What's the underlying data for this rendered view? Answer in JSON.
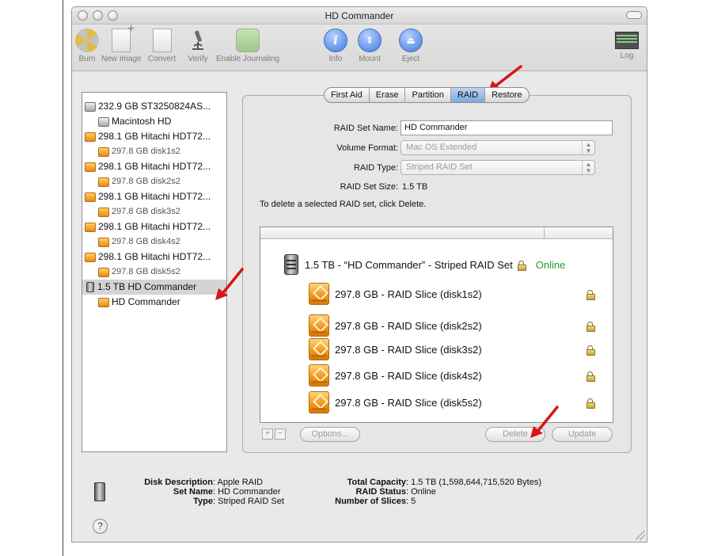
{
  "window": {
    "title": "HD Commander"
  },
  "toolbar": {
    "items": [
      {
        "label": "Burn",
        "icon": "burn-icon"
      },
      {
        "label": "New Image",
        "icon": "new-image-icon"
      },
      {
        "label": "Convert",
        "icon": "convert-icon"
      },
      {
        "label": "Verify",
        "icon": "microscope-icon"
      },
      {
        "label": "Enable Journaling",
        "icon": "journaling-icon"
      },
      {
        "label": "Info",
        "icon": "info-icon"
      },
      {
        "label": "Mount",
        "icon": "mount-icon"
      },
      {
        "label": "Eject",
        "icon": "eject-icon"
      },
      {
        "label": "Log",
        "icon": "log-icon"
      }
    ]
  },
  "sidebar": {
    "items": [
      {
        "label": "232.9 GB ST3250824AS...",
        "icon": "disk-icon"
      },
      {
        "label": "Macintosh HD",
        "icon": "volume-icon"
      },
      {
        "label": "298.1 GB Hitachi HDT72...",
        "icon": "disk-icon"
      },
      {
        "label": "297.8 GB disk1s2",
        "icon": "volume-icon"
      },
      {
        "label": "298.1 GB Hitachi HDT72...",
        "icon": "disk-icon"
      },
      {
        "label": "297.8 GB disk2s2",
        "icon": "volume-icon"
      },
      {
        "label": "298.1 GB Hitachi HDT72...",
        "icon": "disk-icon"
      },
      {
        "label": "297.8 GB disk3s2",
        "icon": "volume-icon"
      },
      {
        "label": "298.1 GB Hitachi HDT72...",
        "icon": "disk-icon"
      },
      {
        "label": "297.8 GB disk4s2",
        "icon": "volume-icon"
      },
      {
        "label": "298.1 GB Hitachi HDT72...",
        "icon": "disk-icon"
      },
      {
        "label": "297.8 GB disk5s2",
        "icon": "volume-icon"
      },
      {
        "label": "1.5 TB HD Commander",
        "icon": "raid-disk-icon"
      },
      {
        "label": "HD Commander",
        "icon": "volume-icon"
      }
    ]
  },
  "tabs": [
    {
      "label": "First Aid"
    },
    {
      "label": "Erase"
    },
    {
      "label": "Partition"
    },
    {
      "label": "RAID",
      "active": true
    },
    {
      "label": "Restore"
    }
  ],
  "raid": {
    "set_name_label": "RAID Set Name:",
    "set_name_value": "HD Commander",
    "volume_format_label": "Volume Format:",
    "volume_format_value": "Mac OS Extended",
    "type_label": "RAID Type:",
    "type_value": "Striped RAID Set",
    "size_label": "RAID Set Size:",
    "size_value": "1.5 TB",
    "delete_note": "To delete a selected RAID set, click Delete.",
    "set_row": {
      "label": "1.5 TB - “HD Commander” - Striped RAID Set",
      "status": "Online"
    },
    "slices": [
      {
        "label": "297.8 GB - RAID Slice (disk1s2)"
      },
      {
        "label": "297.8 GB - RAID Slice (disk2s2)"
      },
      {
        "label": "297.8 GB - RAID Slice (disk3s2)"
      },
      {
        "label": "297.8 GB - RAID Slice (disk4s2)"
      },
      {
        "label": "297.8 GB - RAID Slice (disk5s2)"
      }
    ],
    "add_label": "+",
    "remove_label": "−",
    "options_label": "Options...",
    "delete_label": "Delete",
    "update_label": "Update"
  },
  "info": {
    "left": [
      {
        "key": "Disk Description",
        "value": ": Apple RAID"
      },
      {
        "key": "Set Name",
        "value": ": HD Commander"
      },
      {
        "key": "Type",
        "value": ": Striped RAID Set"
      }
    ],
    "right": [
      {
        "key": "Total Capacity",
        "value": ": 1.5 TB (1,598,644,715,520 Bytes)"
      },
      {
        "key": "RAID Status",
        "value": ": Online"
      },
      {
        "key": "Number of Slices",
        "value": ": 5"
      }
    ],
    "help_label": "?"
  },
  "colors": {
    "online": "#2a9a2a",
    "arrow": "#d81515",
    "selected_tab": "#7ea8df"
  }
}
